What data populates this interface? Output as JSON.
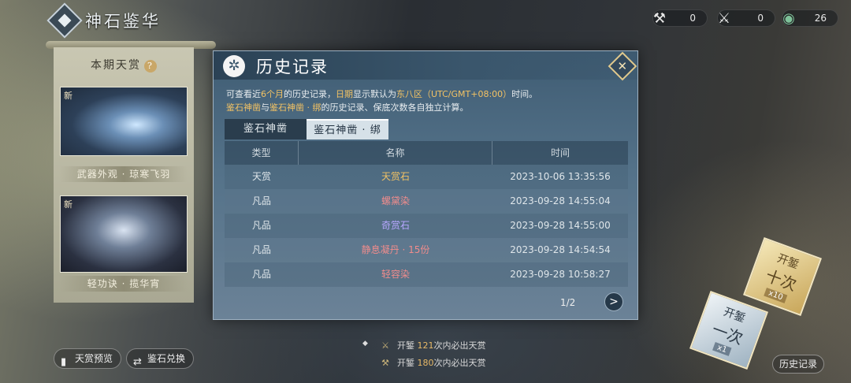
{
  "header": {
    "title": "神石鉴华"
  },
  "currencies": [
    {
      "icon": "tianshang-stone-icon",
      "value": "0"
    },
    {
      "icon": "mouthpiece-icon",
      "value": "0"
    },
    {
      "icon": "jade-icon",
      "value": "26"
    }
  ],
  "banner": {
    "title": "本期天赏",
    "help": "?",
    "new_tag": "新",
    "items": [
      {
        "new": "新",
        "caption": "武器外观 · 琼寒飞羽"
      },
      {
        "new": "新",
        "caption": "轻功诀 · 揽华宵"
      }
    ]
  },
  "left_buttons": {
    "preview": "天赏预览",
    "exchange": "鉴石兑换"
  },
  "dialog": {
    "title": "历史记录",
    "desc1": {
      "p1": "可查看近",
      "months": "6个月",
      "p2": "的历史记录，",
      "date": "日期",
      "p3": "显示默认为",
      "zone": "东八区（UTC/GMT+08:00）",
      "p4": "时间。"
    },
    "desc2": {
      "a": "鉴石神凿",
      "p1": "与",
      "b": "鉴石神凿 · 绑",
      "p2": "的历史记录、保底次数各自独立计算。"
    },
    "tabs": [
      "鉴石神凿",
      "鉴石神凿 · 绑"
    ],
    "columns": [
      "类型",
      "名称",
      "时间"
    ],
    "rows": [
      {
        "type": "天赏",
        "name": "天赏石",
        "time": "2023-10-06 13:35:56",
        "color": "#f2c264"
      },
      {
        "type": "凡品",
        "name": "螺黛染",
        "time": "2023-09-28 14:55:04",
        "color": "#f08c8c"
      },
      {
        "type": "凡品",
        "name": "奇赏石",
        "time": "2023-09-28 14:55:00",
        "color": "#b7a7ff"
      },
      {
        "type": "凡品",
        "name": "静息凝丹 · 15份",
        "time": "2023-09-28 14:54:54",
        "color": "#f08c8c"
      },
      {
        "type": "凡品",
        "name": "轻容染",
        "time": "2023-09-28 10:58:27",
        "color": "#f08c8c"
      }
    ],
    "pager": "1/2",
    "next": ">"
  },
  "pity": {
    "line1": {
      "a": "开錾",
      "n": "121",
      "b": "次内必出天赏"
    },
    "line2": {
      "a": "开錾",
      "n": "180",
      "b": "次内必出天赏"
    }
  },
  "draw": {
    "ten": {
      "a": "开錾",
      "b": "十次",
      "x": "x10"
    },
    "one": {
      "a": "开錾",
      "b": "一次",
      "x": "x1"
    }
  },
  "history_button": "历史记录"
}
